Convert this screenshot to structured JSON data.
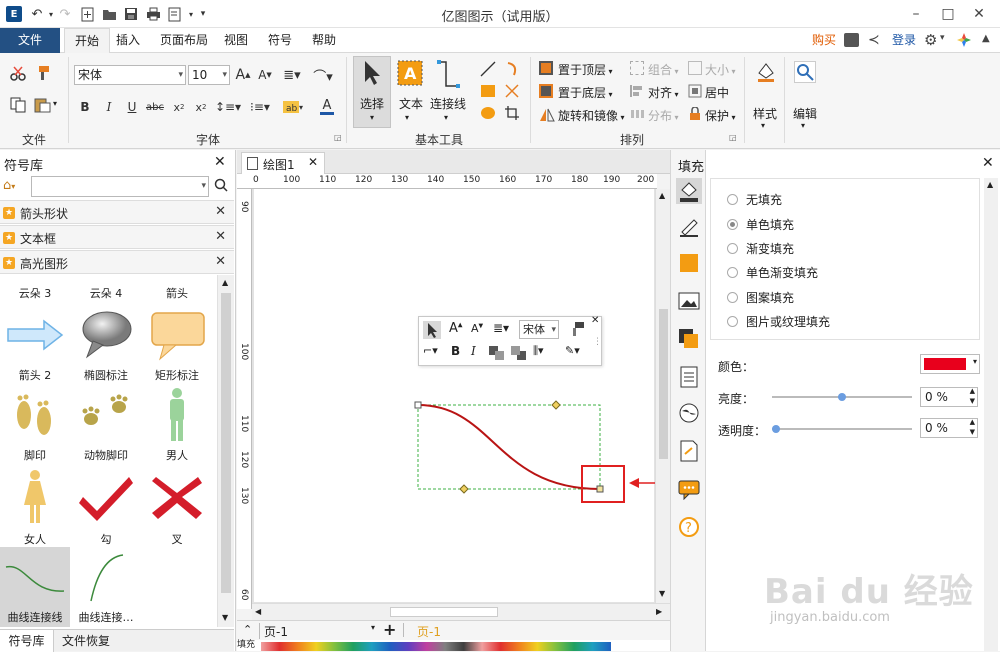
{
  "window": {
    "title": "亿图图示（试用版）",
    "app_logo": "E"
  },
  "menu": {
    "tabs": [
      "文件",
      "开始",
      "插入",
      "页面布局",
      "视图",
      "符号",
      "帮助"
    ],
    "right": {
      "buy": "购买",
      "login": "登录"
    }
  },
  "ribbon": {
    "font_name": "宋体",
    "font_size": "10",
    "groups": {
      "file": "文件",
      "font": "字体",
      "tools": "基本工具",
      "arrange": "排列"
    },
    "tools": {
      "select": "选择",
      "text": "文本",
      "connector": "连接线"
    },
    "arrange": {
      "bring_front": "置于顶层",
      "send_back": "置于底层",
      "rotate": "旋转和镜像",
      "group": "组合",
      "align": "对齐",
      "distribute": "分布",
      "size": "大小",
      "center": "居中",
      "protect": "保护"
    },
    "style_label": "样式",
    "edit_label": "编辑"
  },
  "left_panel": {
    "title": "符号库",
    "search_placeholder": "",
    "libraries": [
      "箭头形状",
      "文本框",
      "高光图形"
    ],
    "shapes": [
      {
        "label": "云朵 3"
      },
      {
        "label": "云朵 4"
      },
      {
        "label": "箭头"
      },
      {
        "label": "箭头 2"
      },
      {
        "label": "椭圆标注"
      },
      {
        "label": "矩形标注"
      },
      {
        "label": "脚印"
      },
      {
        "label": "动物脚印"
      },
      {
        "label": "男人"
      },
      {
        "label": "女人"
      },
      {
        "label": "勾"
      },
      {
        "label": "叉"
      },
      {
        "label": "曲线连接线"
      },
      {
        "label": "曲线连接…"
      }
    ],
    "bottom_tabs": [
      "符号库",
      "文件恢复"
    ]
  },
  "canvas": {
    "doc_tab": "绘图1",
    "ruler_h": [
      "0",
      "100",
      "110",
      "120",
      "130",
      "140",
      "150",
      "160",
      "170",
      "180",
      "190",
      "200"
    ],
    "ruler_v": [
      "90",
      "100",
      "110",
      "120",
      "130",
      "60"
    ],
    "float_toolbar_font": "宋体",
    "page_selector": "页-1",
    "active_page": "页-1",
    "palette_label": "填充"
  },
  "right_panel": {
    "title": "填充",
    "fill_options": [
      "无填充",
      "单色填充",
      "渐变填充",
      "单色渐变填充",
      "图案填充",
      "图片或纹理填充"
    ],
    "selected_fill": "单色填充",
    "color_label": "颜色：",
    "color_value": "#e8001c",
    "brightness_label": "亮度：",
    "brightness_value": "0 %",
    "transparency_label": "透明度：",
    "transparency_value": "0 %"
  },
  "colors": {
    "file_tab": "#235083",
    "curve": "#b91414",
    "selection": "#3cb043",
    "highlight": "#e02020",
    "knob": "#6b9de0"
  },
  "watermark": {
    "logo_text": "Bai du 经验",
    "url": "jingyan.baidu.com"
  }
}
